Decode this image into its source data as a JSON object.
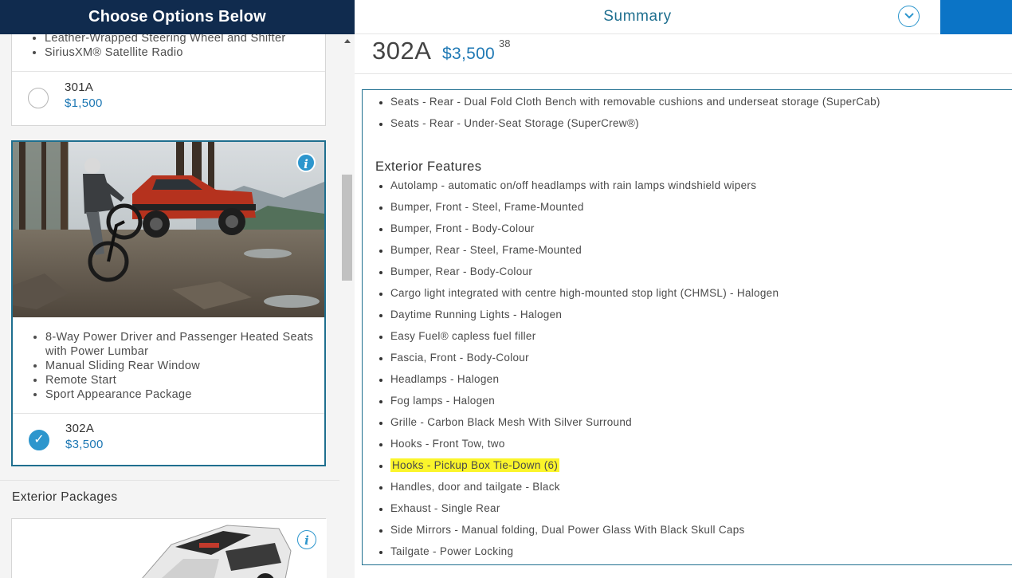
{
  "left_panel": {
    "header_title": "Choose Options Below",
    "card1": {
      "features": [
        "Leather-Wrapped Steering Wheel and Shifter",
        "SiriusXM® Satellite Radio"
      ],
      "package_name": "301A",
      "package_price": "$1,500",
      "selected": false
    },
    "card2": {
      "features": [
        "8-Way Power Driver and Passenger Heated Seats with Power Lumbar",
        "Manual Sliding Rear Window",
        "Remote Start",
        "Sport Appearance Package"
      ],
      "package_name": "302A",
      "package_price": "$3,500",
      "selected": true,
      "info_icon": "info-icon"
    },
    "exterior_section": {
      "label": "Exterior Packages",
      "info_icon": "info-icon"
    }
  },
  "right_panel": {
    "header_title": "Summary",
    "toggle_icon": "chevron-down-icon",
    "package_code": "302A",
    "package_total": "$3,500",
    "package_total_cents": "38",
    "top_features": [
      "Seats - Rear - Dual Fold Cloth Bench with removable cushions and underseat storage (SuperCab)",
      "Seats - Rear - Under-Seat Storage (SuperCrew®)"
    ],
    "exterior_heading": "Exterior Features",
    "exterior_features": [
      "Autolamp - automatic on/off headlamps with rain lamps windshield wipers",
      "Bumper, Front - Steel, Frame-Mounted",
      "Bumper, Front - Body-Colour",
      "Bumper, Rear - Steel, Frame-Mounted",
      "Bumper, Rear - Body-Colour",
      "Cargo light integrated with centre high-mounted stop light (CHMSL) - Halogen",
      "Daytime Running Lights - Halogen",
      "Easy Fuel® capless fuel filler",
      "Fascia, Front - Body-Colour",
      "Headlamps - Halogen",
      "Fog lamps - Halogen",
      "Grille - Carbon Black Mesh With Silver Surround",
      "Hooks - Front Tow, two",
      "Hooks - Pickup Box Tie-Down (6)",
      "Handles, door and tailgate - Black",
      "Exhaust - Single Rear",
      "Side Mirrors - Manual folding, Dual Power Glass With Black Skull Caps",
      "Tailgate - Power Locking"
    ],
    "highlighted_feature_index": 13
  },
  "colors": {
    "header_navy": "#102b4e",
    "accent_blue": "#2d96cd",
    "price_blue": "#1e78b4",
    "teal_border": "#1f6f8f",
    "highlight": "#fbf52b"
  }
}
